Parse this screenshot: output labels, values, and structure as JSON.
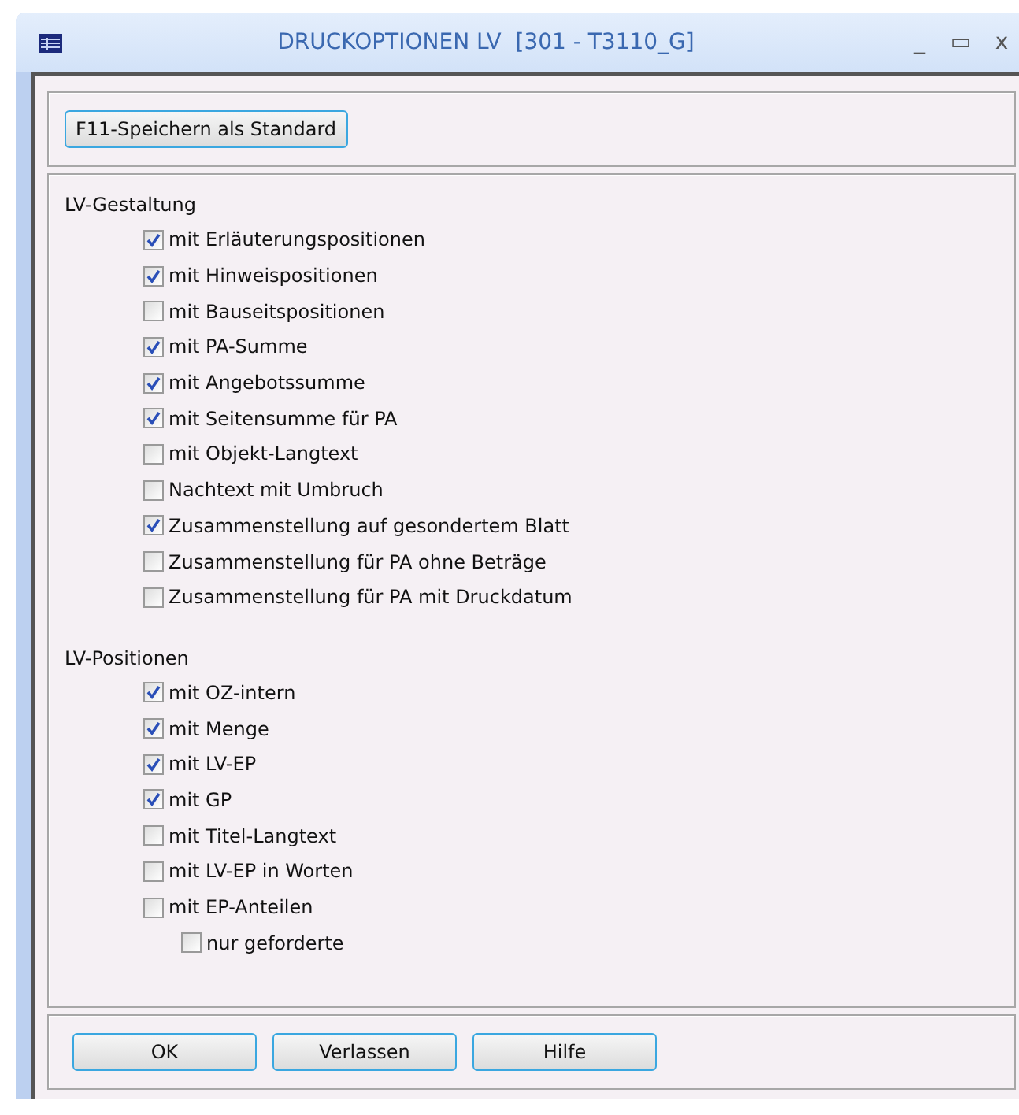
{
  "window": {
    "title": "DRUCKOPTIONEN LV  [301 - T3110_G]",
    "controls": [
      "_",
      "▭",
      "x"
    ]
  },
  "top_button": "F11-Speichern als Standard",
  "groups": [
    {
      "label": "LV-Gestaltung",
      "options": [
        {
          "label": "mit Erläuterungspositionen",
          "checked": true
        },
        {
          "label": "mit Hinweispositionen",
          "checked": true
        },
        {
          "label": "mit Bauseitspositionen",
          "checked": false
        },
        {
          "label": "mit PA-Summe",
          "checked": true
        },
        {
          "label": "mit Angebotssumme",
          "checked": true
        },
        {
          "label": "mit Seitensumme für PA",
          "checked": true
        },
        {
          "label": "mit Objekt-Langtext",
          "checked": false
        },
        {
          "label": "Nachtext mit Umbruch",
          "checked": false
        },
        {
          "label": "Zusammenstellung auf gesondertem Blatt",
          "checked": true
        },
        {
          "label": "Zusammenstellung für PA ohne Beträge",
          "checked": false
        },
        {
          "label": "Zusammenstellung für PA mit Druckdatum",
          "checked": false
        }
      ]
    },
    {
      "label": "LV-Positionen",
      "options": [
        {
          "label": "mit OZ-intern",
          "checked": true
        },
        {
          "label": "mit Menge",
          "checked": true
        },
        {
          "label": "mit LV-EP",
          "checked": true
        },
        {
          "label": "mit GP",
          "checked": true
        },
        {
          "label": "mit Titel-Langtext",
          "checked": false
        },
        {
          "label": "mit LV-EP in Worten",
          "checked": false
        },
        {
          "label": "mit EP-Anteilen",
          "checked": false,
          "children": [
            {
              "label": "nur geforderte",
              "checked": false
            }
          ]
        }
      ]
    }
  ],
  "buttons": [
    "OK",
    "Verlassen",
    "Hilfe"
  ]
}
